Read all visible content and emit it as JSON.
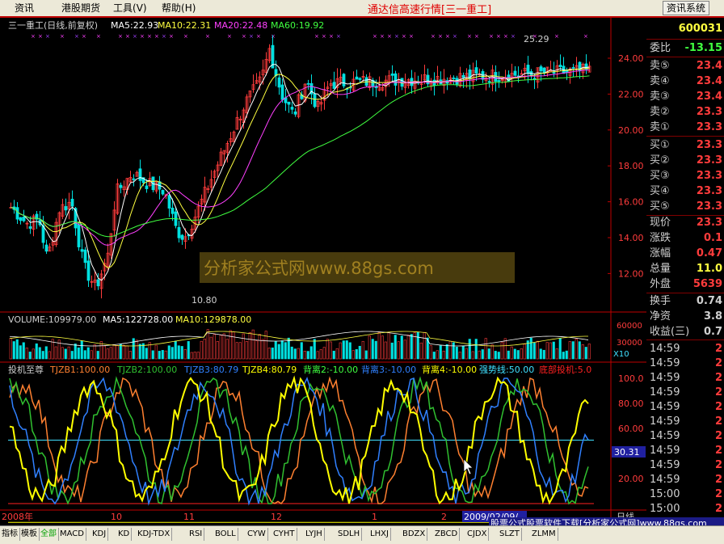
{
  "menu": [
    {
      "label": "资讯"
    },
    {
      "label": "港股期货"
    },
    {
      "label": "工具",
      "key": "(V)"
    },
    {
      "label": "帮助",
      "key": "(H)"
    }
  ],
  "app_title": "通达信高速行情[三一重工]",
  "info_button": "资讯系统",
  "price_panel": {
    "title": "三一重工(日线,前复权)",
    "ma5": "MA5:22.93",
    "ma10": "MA10:22.31",
    "ma20": "MA20:22.48",
    "ma60": "MA60:19.92",
    "y_ticks": [
      "24.00",
      "22.00",
      "20.00",
      "18.00",
      "16.00",
      "14.00",
      "12.00"
    ],
    "high_mark": "25.29",
    "low_mark": "10.80"
  },
  "volume_panel": {
    "label": "VOLUME:109979.00",
    "ma5": "MA5:122728.00",
    "ma10": "MA10:129878.00",
    "y_ticks": [
      "60000",
      "30000"
    ],
    "multiplier": "X10"
  },
  "indicator_panel": {
    "name": "投机至尊",
    "items": [
      "TJZB1:100.00",
      "TJZB2:100.00",
      "TJZB3:80.79",
      "TJZB4:80.79",
      "背离2:-10.00",
      "背离3:-10.00",
      "背离4:-10.00",
      "强势线:50.00",
      "底部投机:5.0"
    ],
    "y_ticks": [
      "100.0",
      "80.00",
      "60.00",
      "40.00",
      "20.00"
    ],
    "cursor_value": "30.31"
  },
  "time_axis": {
    "labels": [
      "2008年",
      "10",
      "11",
      "12",
      "1",
      "2"
    ],
    "cursor_date": "2009/02/09/",
    "period": "日线"
  },
  "right_panel": {
    "code": "600031",
    "weibi_label": "委比",
    "weibi_value": "-13.15",
    "asks": [
      {
        "label": "卖⑤",
        "value": "23.4"
      },
      {
        "label": "卖④",
        "value": "23.4"
      },
      {
        "label": "卖③",
        "value": "23.4"
      },
      {
        "label": "卖②",
        "value": "23.3"
      },
      {
        "label": "卖①",
        "value": "23.3"
      }
    ],
    "bids": [
      {
        "label": "买①",
        "value": "23.3"
      },
      {
        "label": "买②",
        "value": "23.3"
      },
      {
        "label": "买③",
        "value": "23.3"
      },
      {
        "label": "买④",
        "value": "23.3"
      },
      {
        "label": "买⑤",
        "value": "23.3"
      }
    ],
    "stats": [
      {
        "label": "现价",
        "value": "23.3"
      },
      {
        "label": "涨跌",
        "value": "0.1"
      },
      {
        "label": "涨幅",
        "value": "0.47"
      },
      {
        "label": "总量",
        "value": "11.0"
      },
      {
        "label": "外盘",
        "value": "5639"
      }
    ],
    "stats2": [
      {
        "label": "换手",
        "value": "0.74"
      },
      {
        "label": "净资",
        "value": "3.8"
      },
      {
        "label": "收益(三)",
        "value": "0.7"
      }
    ],
    "ticks": [
      "14:59",
      "14:59",
      "14:59",
      "14:59",
      "14:59",
      "14:59",
      "14:59",
      "14:59",
      "14:59",
      "14:59",
      "15:00",
      "15:00"
    ],
    "tick_suffix": "2"
  },
  "bottom_tabs": [
    "指标",
    "模板",
    "全部",
    "MACD",
    "KDJ",
    "KD",
    "KDJ-TDX",
    "RSI",
    "BOLL",
    "CYW",
    "CYHT",
    "LYJH",
    "SDLH",
    "LHXJ",
    "BDZX",
    "ZBCD",
    "CJDX",
    "SLZT",
    "ZLMM"
  ],
  "promo": "股票公式股票软件下载[分析家公式网]www.88gs.com",
  "watermark": "分析家公式网www.88gs.com",
  "colors": {
    "up": "#ff3c3c",
    "down": "#00e0e0",
    "ma5": "#ffffff",
    "ma10": "#ffff40",
    "ma20": "#ff40ff",
    "ma60": "#40ff40",
    "tj1": "#ff8030",
    "tj2": "#30c030",
    "tj3": "#3080ff",
    "tj4": "#ffff00",
    "red_line": "#ff2020",
    "cyan_line": "#40e0ff"
  },
  "chart_data": {
    "type": "candlestick",
    "series": [
      {
        "name": "MA5",
        "values_note": "daily price series"
      },
      {
        "name": "MA10"
      },
      {
        "name": "MA20"
      },
      {
        "name": "MA60"
      }
    ],
    "ylim": [
      11,
      25.5
    ]
  }
}
